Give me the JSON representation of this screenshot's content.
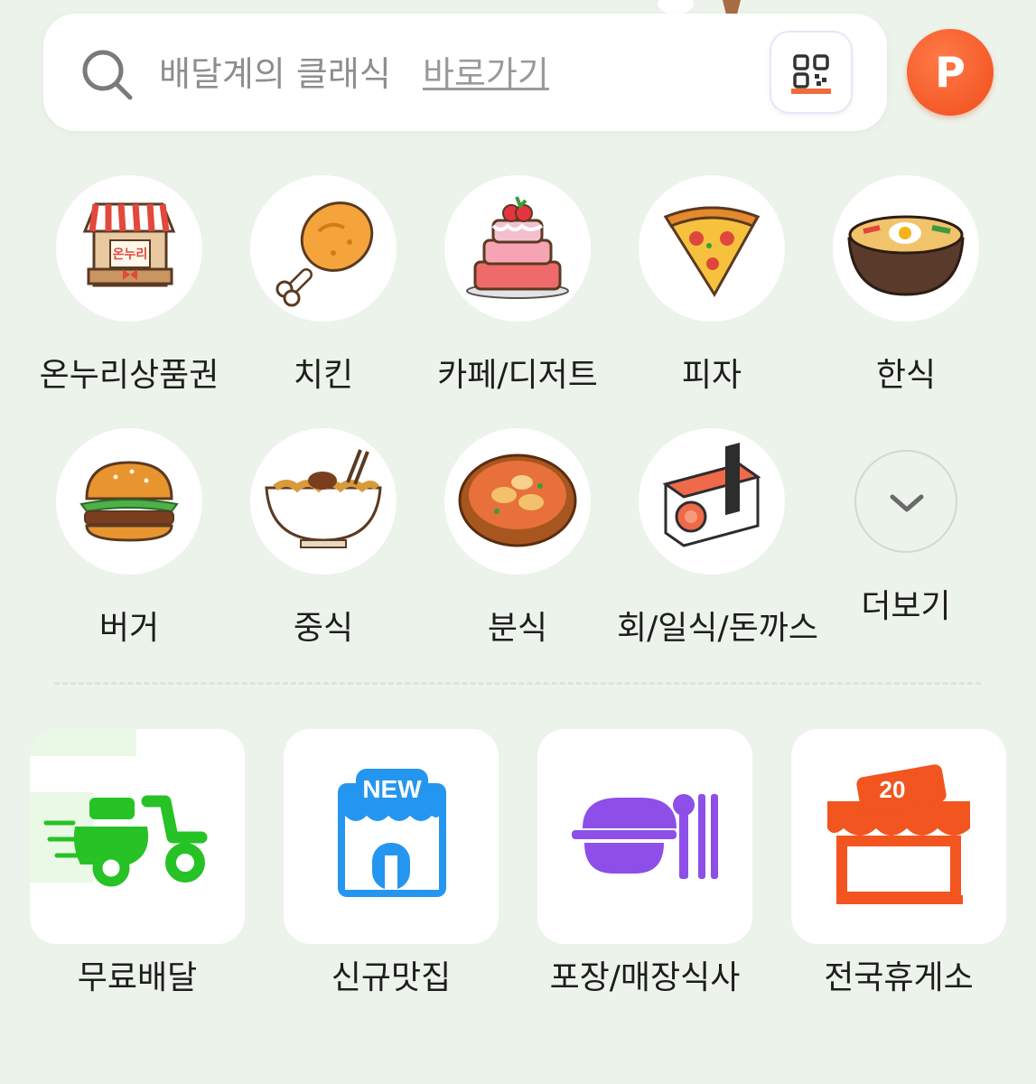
{
  "search": {
    "placeholder": "배달계의 클래식",
    "link": "바로가기"
  },
  "header": {
    "point_label": "P"
  },
  "categories": [
    {
      "label": "온누리상품권",
      "icon": "onnuri-store-icon"
    },
    {
      "label": "치킨",
      "icon": "chicken-leg-icon"
    },
    {
      "label": "카페/디저트",
      "icon": "cake-icon"
    },
    {
      "label": "피자",
      "icon": "pizza-slice-icon"
    },
    {
      "label": "한식",
      "icon": "bibimbap-bowl-icon"
    },
    {
      "label": "버거",
      "icon": "burger-icon"
    },
    {
      "label": "중식",
      "icon": "noodle-bowl-icon"
    },
    {
      "label": "분식",
      "icon": "tteokbokki-bowl-icon"
    },
    {
      "label": "회/일식/돈까스",
      "icon": "sushi-icon"
    },
    {
      "label": "더보기",
      "icon": "chevron-down-icon"
    }
  ],
  "services": [
    {
      "label": "무료배달",
      "icon": "delivery-scooter-icon"
    },
    {
      "label": "신규맛집",
      "icon": "new-store-icon",
      "badge": "NEW"
    },
    {
      "label": "포장/매장식사",
      "icon": "takeout-cutlery-icon"
    },
    {
      "label": "전국휴게소",
      "icon": "rest-area-store-icon",
      "badge": "20"
    }
  ],
  "colors": {
    "background": "#ecf3ea",
    "point": "#f04d1c",
    "delivery": "#26c226",
    "new_store": "#2596f0",
    "takeout": "#8d4fe8",
    "rest_area": "#f2551f"
  }
}
